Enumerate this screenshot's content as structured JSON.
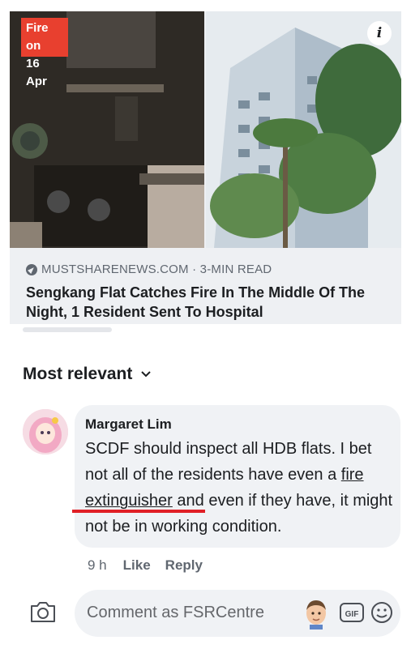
{
  "preview": {
    "badge_line1": "Fire on",
    "badge_line2": "16 Apr",
    "info_glyph": "i",
    "source": "MUSTSHARENEWS.COM · 3-MIN READ",
    "headline": "Sengkang Flat Catches Fire In The Middle Of The Night, 1 Resident Sent To Hospital",
    "badge_color": "#e8402f"
  },
  "sort": {
    "label": "Most relevant",
    "icon": "chevron-down-icon"
  },
  "comment": {
    "author": "Margaret Lim",
    "text_before": "SCDF should inspect all HDB flats. I bet not all of the residents have even a ",
    "text_highlight": "fire extinguisher",
    "text_after": " and even if they have, it might not be in working condition.",
    "highlight_color": "#e01f26",
    "time": "9 h",
    "like_label": "Like",
    "reply_label": "Reply"
  },
  "composer": {
    "placeholder": "Comment as FSRCentre",
    "icons": [
      "camera-icon",
      "memoji-avatar",
      "gif-icon",
      "smiley-icon"
    ]
  }
}
